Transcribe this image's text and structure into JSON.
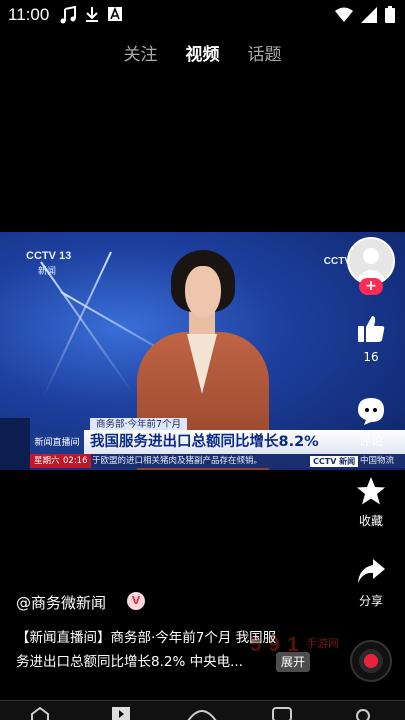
{
  "status_bar": {
    "time": "11:00",
    "icons_left": [
      "music-note-icon",
      "download-icon",
      "font-a-icon"
    ],
    "icons_right": [
      "wifi-icon",
      "signal-icon",
      "battery-icon"
    ]
  },
  "top_tabs": [
    {
      "label": "关注",
      "active": false
    },
    {
      "label": "视频",
      "active": true
    },
    {
      "label": "话题",
      "active": false
    }
  ],
  "video": {
    "channel_logo": "CCTV 13",
    "channel_sub": "新闻",
    "channel_logo_right": "CCTV",
    "lower_third": {
      "source_label": "商务部·今年前7个月",
      "program_logo": "新闻直播间",
      "headline": "我国服务进出口总额同比增长8.2%",
      "weekday": "星期六",
      "clock": "02:16",
      "ticker": "于欧盟的进口相关猪肉及猪副产品存在倾销。",
      "network_badge": "CCTV 新闻",
      "ticker_right": "中国物流"
    }
  },
  "actions": {
    "like_count": "16",
    "comment_label": "评论",
    "favorite_label": "收藏",
    "share_label": "分享"
  },
  "post": {
    "author": "@商务微新闻",
    "author_badge": "V",
    "caption_line1": "【新闻直播间】商务部·今年前7个月 我国服",
    "caption_line2": "务进出口总额同比增长8.2%  中央电...",
    "expand_label": "展开",
    "watermark": "5 9 1",
    "watermark_sub": "手游网"
  },
  "colors": {
    "accent": "#fe2c55",
    "headline_text": "#0b2a86"
  }
}
